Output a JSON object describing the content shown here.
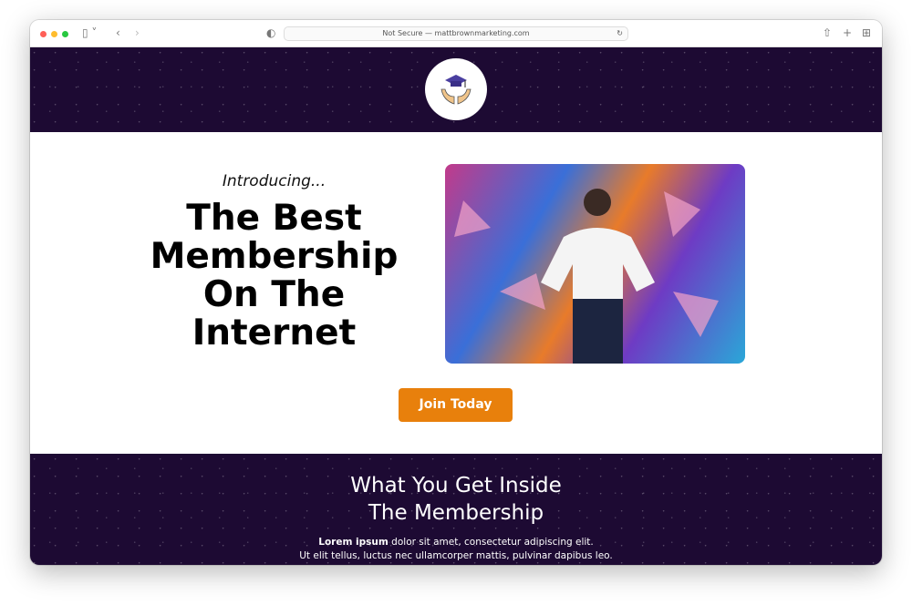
{
  "browser": {
    "url": "Not Secure — mattbrownmarketing.com",
    "traffic_lights": [
      "#ff5f57",
      "#febc2e",
      "#28c840"
    ]
  },
  "hero": {
    "intro": "Introducing...",
    "title": "The Best Membership On The Internet",
    "cta": "Join Today",
    "cta_color": "#e8800c"
  },
  "section": {
    "title_line1": "What You Get Inside",
    "title_line2": "The Membership",
    "body_bold": "Lorem ipsum",
    "body_rest": " dolor sit amet, consectetur adipiscing elit.",
    "body_line2": "Ut elit tellus, luctus nec ullamcorper mattis, pulvinar dapibus leo."
  }
}
